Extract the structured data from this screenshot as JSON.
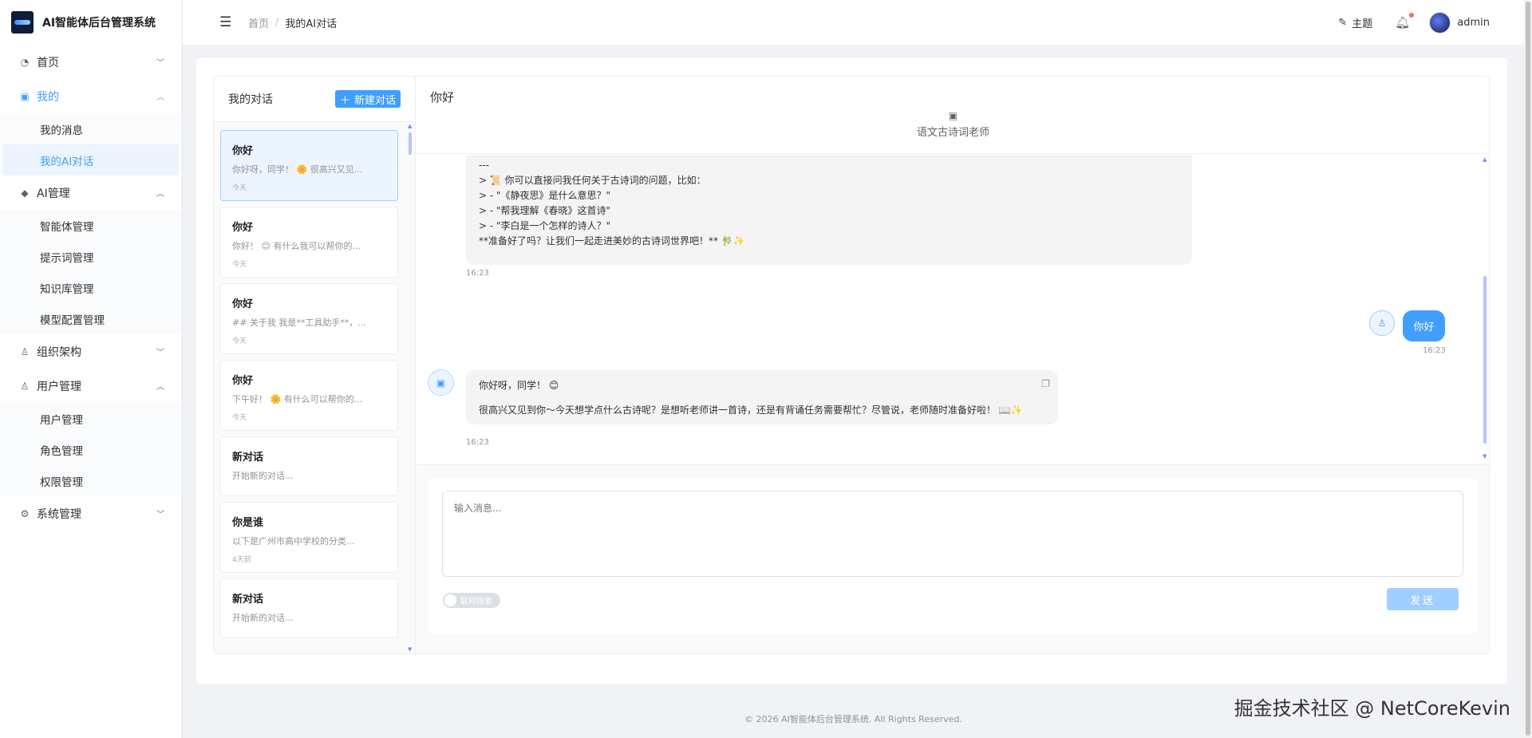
{
  "app": {
    "title": "AI智能体后台管理系统"
  },
  "sidebar": {
    "home": {
      "label": "首页"
    },
    "mine": {
      "label": "我的",
      "children": [
        "我的消息",
        "我的AI对话"
      ]
    },
    "ai": {
      "label": "AI管理",
      "children": [
        "智能体管理",
        "提示词管理",
        "知识库管理",
        "模型配置管理"
      ]
    },
    "org": {
      "label": "组织架构"
    },
    "users": {
      "label": "用户管理",
      "children": [
        "用户管理",
        "角色管理",
        "权限管理"
      ]
    },
    "system": {
      "label": "系统管理"
    }
  },
  "header": {
    "breadcrumb": [
      "首页",
      "/",
      "我的AI对话"
    ],
    "theme_label": "主题",
    "user_name": "admin"
  },
  "conversations": {
    "title": "我的对话",
    "new_label": "新建对话",
    "items": [
      {
        "name": "你好",
        "preview": "你好呀，同学！ 🌼 很高兴又见...",
        "time": "今天"
      },
      {
        "name": "你好",
        "preview": "你好！ 😊 有什么我可以帮你的...",
        "time": "今天"
      },
      {
        "name": "你好",
        "preview": "## 关于我 我是**工具助手**，...",
        "time": "今天"
      },
      {
        "name": "你好",
        "preview": "下午好！ 🌼 有什么可以帮你的...",
        "time": "今天"
      },
      {
        "name": "新对话",
        "preview": "开始新的对话...",
        "time": ""
      },
      {
        "name": "你是谁",
        "preview": "以下是广州市高中学校的分类...",
        "time": "4天前"
      },
      {
        "name": "新对话",
        "preview": "开始新的对话...",
        "time": ""
      }
    ]
  },
  "chat": {
    "title": "你好",
    "agent_name": "语文古诗词老师",
    "top_message_lines": [
      "---",
      "",
      "> 📜 你可以直接问我任何关于古诗词的问题，比如：",
      "> - \"《静夜思》是什么意思？\"",
      "> - \"帮我理解《春晓》这首诗\"",
      "> - \"李白是一个怎样的诗人？\"",
      "",
      "**准备好了吗？让我们一起走进美妙的古诗词世界吧！** 🎋✨"
    ],
    "top_message_time": "16:23",
    "user_message": "你好",
    "user_message_time": "16:23",
    "ai_reply_line1": "你好呀，同学！ 😊",
    "ai_reply_line2": "很高兴又见到你～今天想学点什么古诗呢？是想听老师讲一首诗，还是有背诵任务需要帮忙？尽管说，老师随时准备好啦！ 📖✨",
    "ai_reply_time": "16:23"
  },
  "composer": {
    "placeholder": "输入消息...",
    "toggle_label": "联网搜索",
    "send_label": "发送"
  },
  "footer": {
    "text": "© 2026 AI智能体后台管理系统. All Rights Reserved."
  },
  "watermark": "掘金技术社区 @ NetCoreKevin"
}
